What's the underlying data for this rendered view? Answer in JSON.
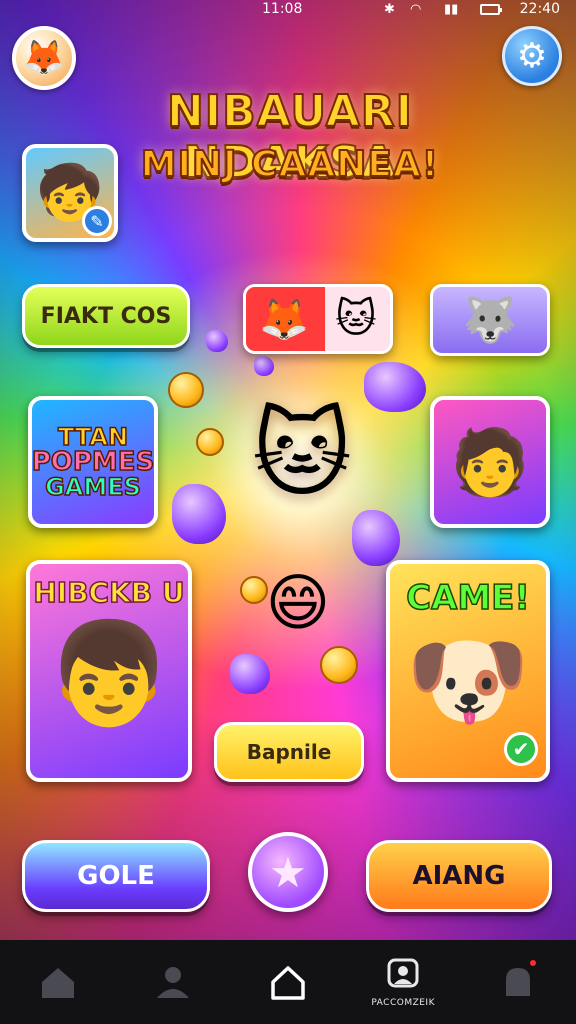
{
  "status_bar": {
    "left_time": "11:08",
    "right_time": "22:40"
  },
  "header": {
    "title_line1": "NIBAUARI NDAKSA",
    "title_line2": "MINJ CAANEA!"
  },
  "buttons": {
    "top_left_pill": "FIAKT COS",
    "center_pill": "Bapnile",
    "bottom_left": "GOLE",
    "bottom_right": "AIANG"
  },
  "tiles": {
    "left_tile_lines": [
      "TTAN",
      "POPMES",
      "GAMES"
    ],
    "big_left_heading": "HIBCKB U",
    "big_right_heading": "CAME!"
  },
  "icons": {
    "avatar": "fox-avatar",
    "settings": "gear-icon",
    "star": "star-icon"
  },
  "bottom_nav": {
    "items": [
      {
        "name": "home-outline",
        "label": ""
      },
      {
        "name": "profile",
        "label": ""
      },
      {
        "name": "home",
        "label": "",
        "active": true
      },
      {
        "name": "account",
        "label": "PACCOMZEIK"
      },
      {
        "name": "notifications",
        "label": ""
      }
    ]
  },
  "colors": {
    "title_gold": "#ffd32a",
    "pill_green": "#8fd61a",
    "pill_yellow": "#ffc21a",
    "accent_purple": "#7a3cff",
    "nav_bg": "#121214"
  }
}
